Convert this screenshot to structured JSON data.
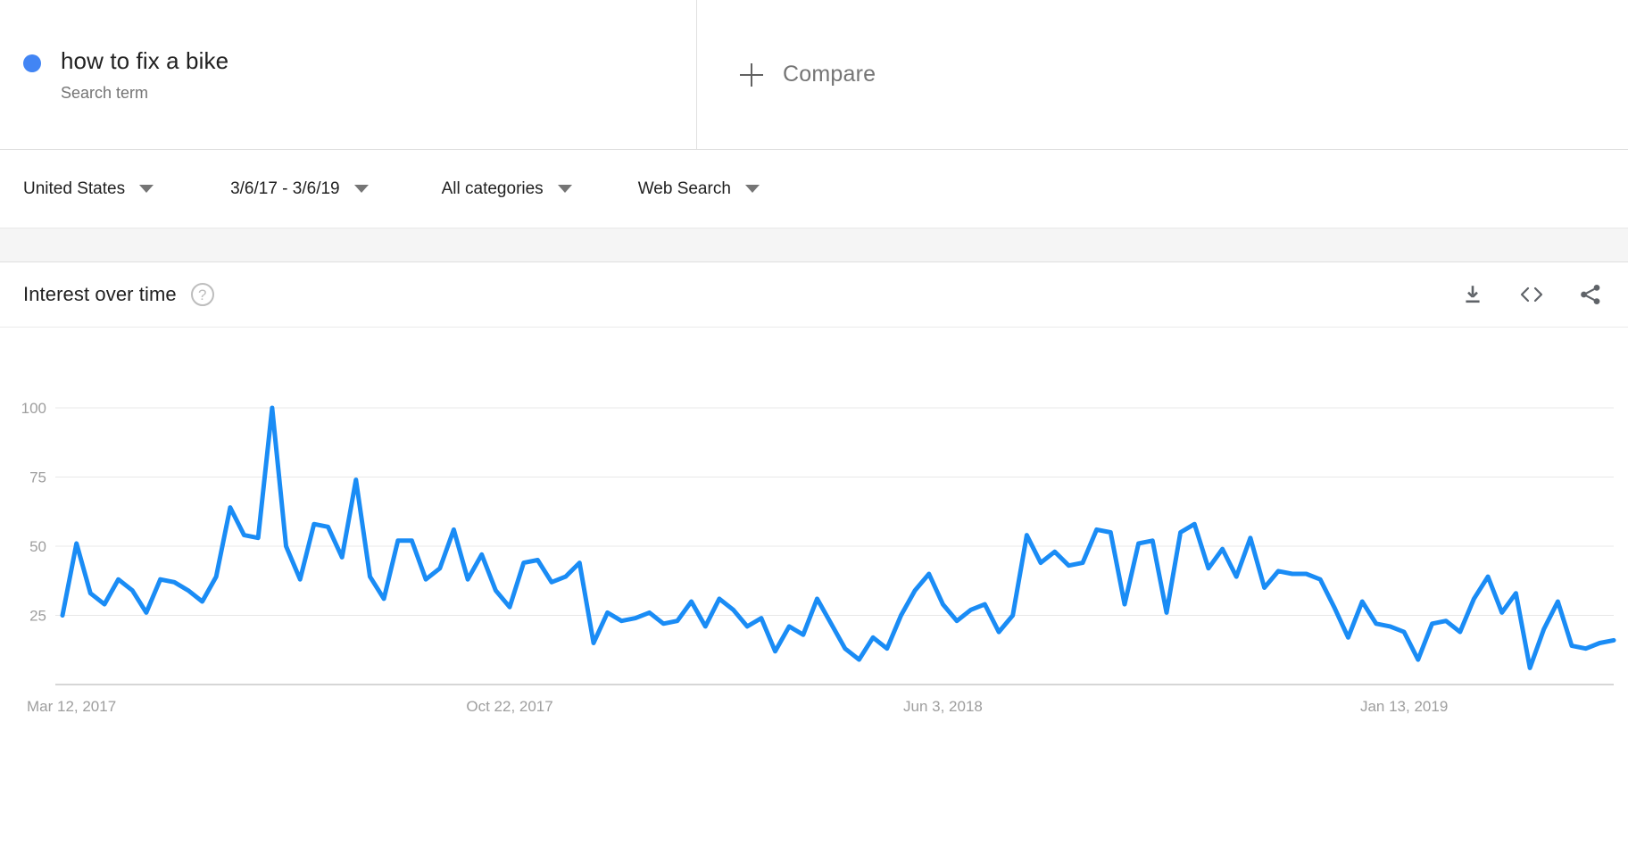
{
  "term": {
    "title": "how to fix a bike",
    "subtitle": "Search term",
    "dot_color": "#4285F4"
  },
  "compare": {
    "label": "Compare",
    "icon": "plus-icon"
  },
  "filters": {
    "region": "United States",
    "time_range": "3/6/17 - 3/6/19",
    "category": "All categories",
    "search_type": "Web Search"
  },
  "card": {
    "title": "Interest over time",
    "help_icon": "help-circle-icon",
    "actions": [
      {
        "name": "download-icon",
        "glyph": "download"
      },
      {
        "name": "embed-icon",
        "glyph": "<>"
      },
      {
        "name": "share-icon",
        "glyph": "share"
      }
    ]
  },
  "chart_data": {
    "type": "line",
    "title": "Interest over time",
    "xlabel": "",
    "ylabel": "",
    "ylim": [
      0,
      100
    ],
    "yticks": [
      25,
      50,
      75,
      100
    ],
    "grid": true,
    "legend": false,
    "line_color": "#1A8CF5",
    "x_tick_labels": [
      "Mar 12, 2017",
      "Oct 22, 2017",
      "Jun 3, 2018",
      "Jan 13, 2019"
    ],
    "x_tick_index": [
      0,
      32,
      63,
      96
    ],
    "series": [
      {
        "name": "how to fix a bike",
        "values": [
          25,
          51,
          33,
          29,
          38,
          34,
          26,
          38,
          37,
          34,
          30,
          39,
          64,
          54,
          53,
          100,
          50,
          38,
          58,
          57,
          46,
          74,
          39,
          31,
          52,
          52,
          38,
          42,
          56,
          38,
          47,
          34,
          28,
          44,
          45,
          37,
          39,
          44,
          15,
          26,
          23,
          24,
          26,
          22,
          23,
          30,
          21,
          31,
          27,
          21,
          24,
          12,
          21,
          18,
          31,
          22,
          13,
          9,
          17,
          13,
          25,
          34,
          40,
          29,
          23,
          27,
          29,
          19,
          25,
          54,
          44,
          48,
          43,
          44,
          56,
          55,
          29,
          51,
          52,
          26,
          55,
          58,
          42,
          49,
          39,
          53,
          35,
          41,
          40,
          40,
          38,
          28,
          17,
          30,
          22,
          21,
          19,
          9,
          22,
          23,
          19,
          31,
          39,
          26,
          33,
          6,
          20,
          30,
          14,
          13,
          15,
          16
        ]
      }
    ]
  }
}
